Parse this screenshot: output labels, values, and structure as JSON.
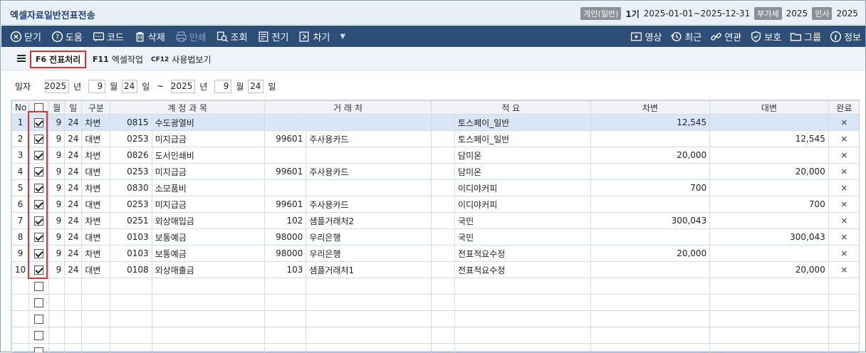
{
  "window": {
    "title": "엑셀자료일반전표전송",
    "period": {
      "type_tag": "개인(일반)",
      "term": "1기",
      "range": "2025-01-01~2025-12-31",
      "vat_tag": "부가세",
      "vat_year": "2025",
      "hr_tag": "인사",
      "hr_year": "2025"
    }
  },
  "toolbar": {
    "left": [
      {
        "label": "닫기",
        "icon": "close-circle-icon"
      },
      {
        "label": "도움",
        "icon": "help-icon"
      },
      {
        "label": "코드",
        "icon": "code-icon"
      },
      {
        "label": "삭제",
        "icon": "trash-icon"
      },
      {
        "label": "인쇄",
        "icon": "print-icon",
        "disabled": true
      },
      {
        "label": "조회",
        "icon": "search-icon"
      },
      {
        "label": "전기",
        "icon": "post-icon"
      },
      {
        "label": "차기",
        "icon": "next-icon"
      }
    ],
    "right": [
      {
        "label": "영상",
        "icon": "video-icon"
      },
      {
        "label": "최근",
        "icon": "history-icon"
      },
      {
        "label": "연관",
        "icon": "link-icon"
      },
      {
        "label": "보호",
        "icon": "shield-icon"
      },
      {
        "label": "그룹",
        "icon": "folder-icon"
      },
      {
        "label": "정보",
        "icon": "info-icon"
      }
    ]
  },
  "functions": {
    "f6": {
      "key": "F6",
      "label": "전표처리"
    },
    "f11": {
      "key": "F11",
      "label": "엑셀작업"
    },
    "f12": {
      "key": "CF12",
      "label": "사용법보기"
    }
  },
  "filter": {
    "label": "일자",
    "from": {
      "year": "2025",
      "month": "9",
      "day": "24"
    },
    "to": {
      "year": "2025",
      "month": "9",
      "day": "24"
    },
    "year_unit": "년",
    "month_unit": "월",
    "day_unit": "일",
    "tilde": "~"
  },
  "grid": {
    "headers": {
      "no": "No",
      "month": "월",
      "day": "일",
      "type": "구분",
      "account": "계 정 과 목",
      "vendor": "거 래 처",
      "memo": "적 요",
      "debit": "차변",
      "credit": "대변",
      "done": "완료"
    },
    "rows": [
      {
        "no": "1",
        "checked": true,
        "month": "9",
        "day": "24",
        "type": "차변",
        "acode": "0815",
        "aname": "수도광열비",
        "vcode": "",
        "vname": "",
        "memo": "토스페이_일반",
        "debit": "12,545",
        "credit": "",
        "done": "×"
      },
      {
        "no": "2",
        "checked": true,
        "month": "9",
        "day": "24",
        "type": "대변",
        "acode": "0253",
        "aname": "미지급금",
        "vcode": "99601",
        "vname": "주사용카드",
        "memo": "토스페이_일반",
        "debit": "",
        "credit": "12,545",
        "done": "×"
      },
      {
        "no": "3",
        "checked": true,
        "month": "9",
        "day": "24",
        "type": "차변",
        "acode": "0826",
        "aname": "도서인쇄비",
        "vcode": "",
        "vname": "",
        "memo": "담미온",
        "debit": "20,000",
        "credit": "",
        "done": "×"
      },
      {
        "no": "4",
        "checked": true,
        "month": "9",
        "day": "24",
        "type": "대변",
        "acode": "0253",
        "aname": "미지급금",
        "vcode": "99601",
        "vname": "주사용카드",
        "memo": "담미온",
        "debit": "",
        "credit": "20,000",
        "done": "×"
      },
      {
        "no": "5",
        "checked": true,
        "month": "9",
        "day": "24",
        "type": "차변",
        "acode": "0830",
        "aname": "소모품비",
        "vcode": "",
        "vname": "",
        "memo": "이디야커피",
        "debit": "700",
        "credit": "",
        "done": "×"
      },
      {
        "no": "6",
        "checked": true,
        "month": "9",
        "day": "24",
        "type": "대변",
        "acode": "0253",
        "aname": "미지급금",
        "vcode": "99601",
        "vname": "주사용카드",
        "memo": "이디야커피",
        "debit": "",
        "credit": "700",
        "done": "×"
      },
      {
        "no": "7",
        "checked": true,
        "month": "9",
        "day": "24",
        "type": "차변",
        "acode": "0251",
        "aname": "외상매입금",
        "vcode": "102",
        "vname": "샘플거래처2",
        "memo": "국민",
        "debit": "300,043",
        "credit": "",
        "done": "×"
      },
      {
        "no": "8",
        "checked": true,
        "month": "9",
        "day": "24",
        "type": "대변",
        "acode": "0103",
        "aname": "보통예금",
        "vcode": "98000",
        "vname": "우리은행",
        "memo": "국민",
        "debit": "",
        "credit": "300,043",
        "done": "×"
      },
      {
        "no": "9",
        "checked": true,
        "month": "9",
        "day": "24",
        "type": "차변",
        "acode": "0103",
        "aname": "보통예금",
        "vcode": "98000",
        "vname": "우리은행",
        "memo": "전표적요수정",
        "debit": "20,000",
        "credit": "",
        "done": "×"
      },
      {
        "no": "10",
        "checked": true,
        "month": "9",
        "day": "24",
        "type": "대변",
        "acode": "0108",
        "aname": "외상매출금",
        "vcode": "103",
        "vname": "샘플거래처1",
        "memo": "전표적요수정",
        "debit": "",
        "credit": "20,000",
        "done": "×"
      }
    ],
    "empty_rows": 5,
    "selected_row": 0
  }
}
